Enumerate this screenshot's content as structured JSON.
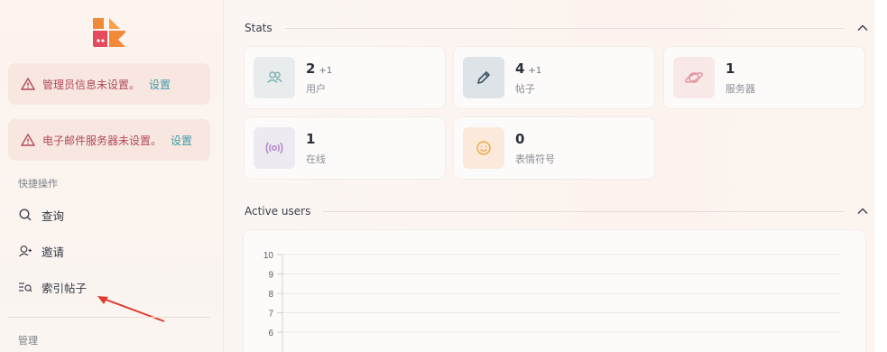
{
  "alerts": [
    {
      "text": "管理员信息未设置。",
      "link": "设置"
    },
    {
      "text": "电子邮件服务器未设置。",
      "link": "设置"
    }
  ],
  "quick_actions": {
    "label": "快捷操作",
    "items": [
      {
        "label": "查询",
        "icon": "search-icon"
      },
      {
        "label": "邀请",
        "icon": "invite-user-icon"
      },
      {
        "label": "索引帖子",
        "icon": "index-posts-icon"
      }
    ]
  },
  "manage_label": "管理",
  "stats": {
    "title": "Stats",
    "cards": [
      {
        "value": "2",
        "delta": "+1",
        "label": "用户",
        "icon": "users-icon",
        "bg": "#e9ecec",
        "color": "#7eb3b6"
      },
      {
        "value": "4",
        "delta": "+1",
        "label": "帖子",
        "icon": "pencil-icon",
        "bg": "#dde3e6",
        "color": "#3b5262"
      },
      {
        "value": "1",
        "delta": "",
        "label": "服务器",
        "icon": "planet-icon",
        "bg": "#f8e8e8",
        "color": "#e1969c"
      },
      {
        "value": "1",
        "delta": "",
        "label": "在线",
        "icon": "broadcast-icon",
        "bg": "#eeeaf1",
        "color": "#b284cc"
      },
      {
        "value": "0",
        "delta": "",
        "label": "表情符号",
        "icon": "smile-icon",
        "bg": "#fbeadb",
        "color": "#f2a94a"
      }
    ]
  },
  "active_users": {
    "title": "Active users"
  },
  "chart_data": {
    "type": "line",
    "title": "",
    "xlabel": "",
    "ylabel": "",
    "ylim": [
      6,
      10
    ],
    "yticks": [
      "10",
      "9",
      "8",
      "7",
      "6"
    ],
    "series": []
  }
}
